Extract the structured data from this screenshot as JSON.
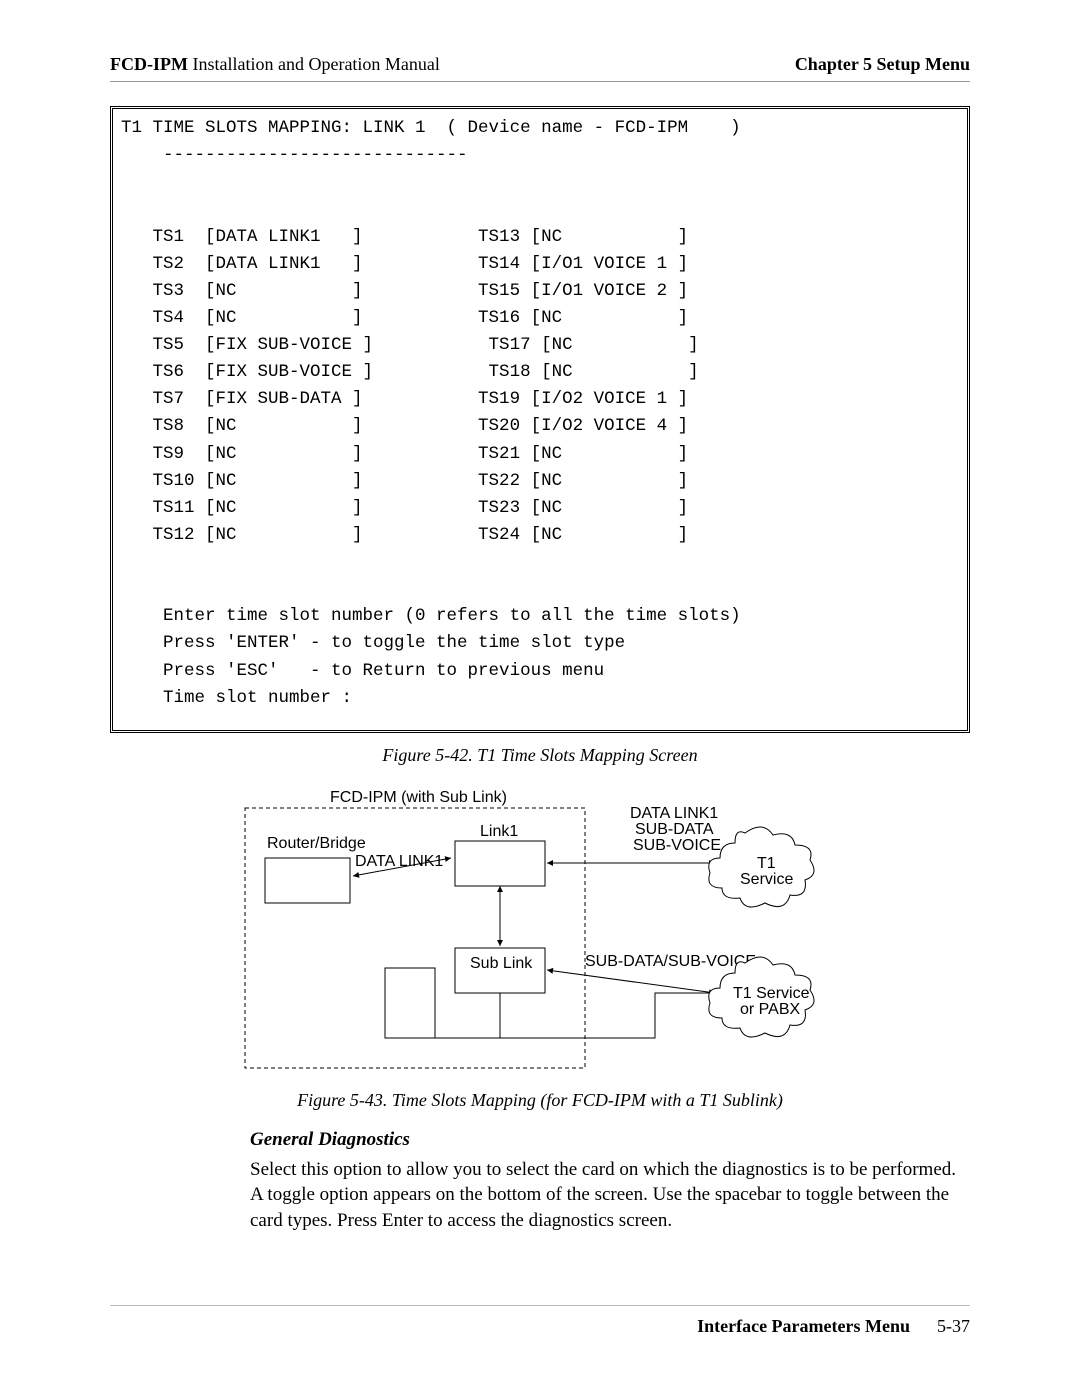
{
  "header": {
    "product": "FCD-IPM",
    "doc": " Installation and Operation Manual",
    "chapter": "Chapter 5  Setup Menu"
  },
  "terminal": {
    "title": "T1 TIME SLOTS MAPPING: LINK 1  ( Device name - FCD-IPM    )",
    "divider": "-----------------------------",
    "left": [
      {
        "id": "TS1",
        "val": "DATA LINK1   "
      },
      {
        "id": "TS2",
        "val": "DATA LINK1   "
      },
      {
        "id": "TS3",
        "val": "NC           "
      },
      {
        "id": "TS4",
        "val": "NC           "
      },
      {
        "id": "TS5",
        "val": "FIX SUB-VOICE "
      },
      {
        "id": "TS6",
        "val": "FIX SUB-VOICE "
      },
      {
        "id": "TS7",
        "val": "FIX SUB-DATA "
      },
      {
        "id": "TS8",
        "val": "NC           "
      },
      {
        "id": "TS9",
        "val": "NC           "
      },
      {
        "id": "TS10",
        "val": "NC           "
      },
      {
        "id": "TS11",
        "val": "NC           "
      },
      {
        "id": "TS12",
        "val": "NC           "
      }
    ],
    "right": [
      {
        "id": "TS13",
        "val": "NC           "
      },
      {
        "id": "TS14",
        "val": "I/O1 VOICE 1 "
      },
      {
        "id": "TS15",
        "val": "I/O1 VOICE 2 "
      },
      {
        "id": "TS16",
        "val": "NC           "
      },
      {
        "id": "TS17",
        "val": "NC           "
      },
      {
        "id": "TS18",
        "val": "NC           "
      },
      {
        "id": "TS19",
        "val": "I/O2 VOICE 1 "
      },
      {
        "id": "TS20",
        "val": "I/O2 VOICE 4 "
      },
      {
        "id": "TS21",
        "val": "NC           "
      },
      {
        "id": "TS22",
        "val": "NC           "
      },
      {
        "id": "TS23",
        "val": "NC           "
      },
      {
        "id": "TS24",
        "val": "NC           "
      }
    ],
    "instr1": "Enter time slot number (0 refers to all the time slots)",
    "instr2": "Press 'ENTER' - to toggle the time slot type",
    "instr3": "Press 'ESC'   - to Return to previous menu",
    "instr4": "Time slot number :"
  },
  "fig42": "Figure 5-42.  T1 Time Slots Mapping Screen",
  "diagram": {
    "outer_label": "FCD-IPM (with Sub Link)",
    "router": "Router/Bridge",
    "datalink": "DATA LINK1",
    "link1": "Link1",
    "sublink": "Sub Link",
    "top_right": "DATA LINK1\nSUB-DATA\nSUB-VOICE",
    "cloud1": "T1\nService",
    "sub_right": "SUB-DATA/SUB-VOICE",
    "cloud2": "T1 Service\nor PABX"
  },
  "fig43": "Figure 5-43.  Time Slots Mapping (for FCD-IPM with a T1 Sublink)",
  "section": {
    "title": "General Diagnostics",
    "body": "Select this option to allow you to select the card on which the diagnostics is to be performed. A toggle option appears on the bottom of the screen.  Use the spacebar to toggle between the card types. Press Enter to access the diagnostics screen."
  },
  "footer": {
    "section": "Interface Parameters Menu",
    "page": "5-37"
  }
}
